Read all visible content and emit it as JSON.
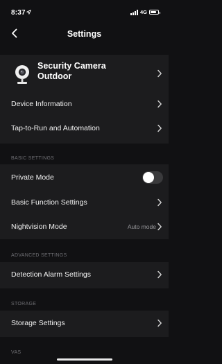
{
  "status_bar": {
    "time": "8:37",
    "network": "4G",
    "battery_level": 0.8
  },
  "nav": {
    "title": "Settings"
  },
  "device": {
    "name_line1": "Security Camera",
    "name_line2": "Outdoor"
  },
  "general_items": [
    {
      "label": "Device Information"
    },
    {
      "label": "Tap-to-Run and Automation"
    }
  ],
  "basic_settings": {
    "header": "BASIC SETTINGS",
    "private_mode": {
      "label": "Private Mode",
      "on": false
    },
    "basic_function": {
      "label": "Basic Function Settings"
    },
    "nightvision": {
      "label": "Nightvision Mode",
      "value": "Auto mode"
    }
  },
  "advanced_settings": {
    "header": "ADVANCED SETTINGS",
    "detection_alarm": {
      "label": "Detection Alarm Settings"
    }
  },
  "storage": {
    "header": "STORAGE",
    "storage_settings": {
      "label": "Storage Settings"
    }
  },
  "vas": {
    "header": "VAS"
  },
  "colors": {
    "background": "#111113",
    "group_background": "#1c1c1e",
    "toggle_off": "#3a3a3c",
    "secondary_text": "#9a9a9e"
  }
}
